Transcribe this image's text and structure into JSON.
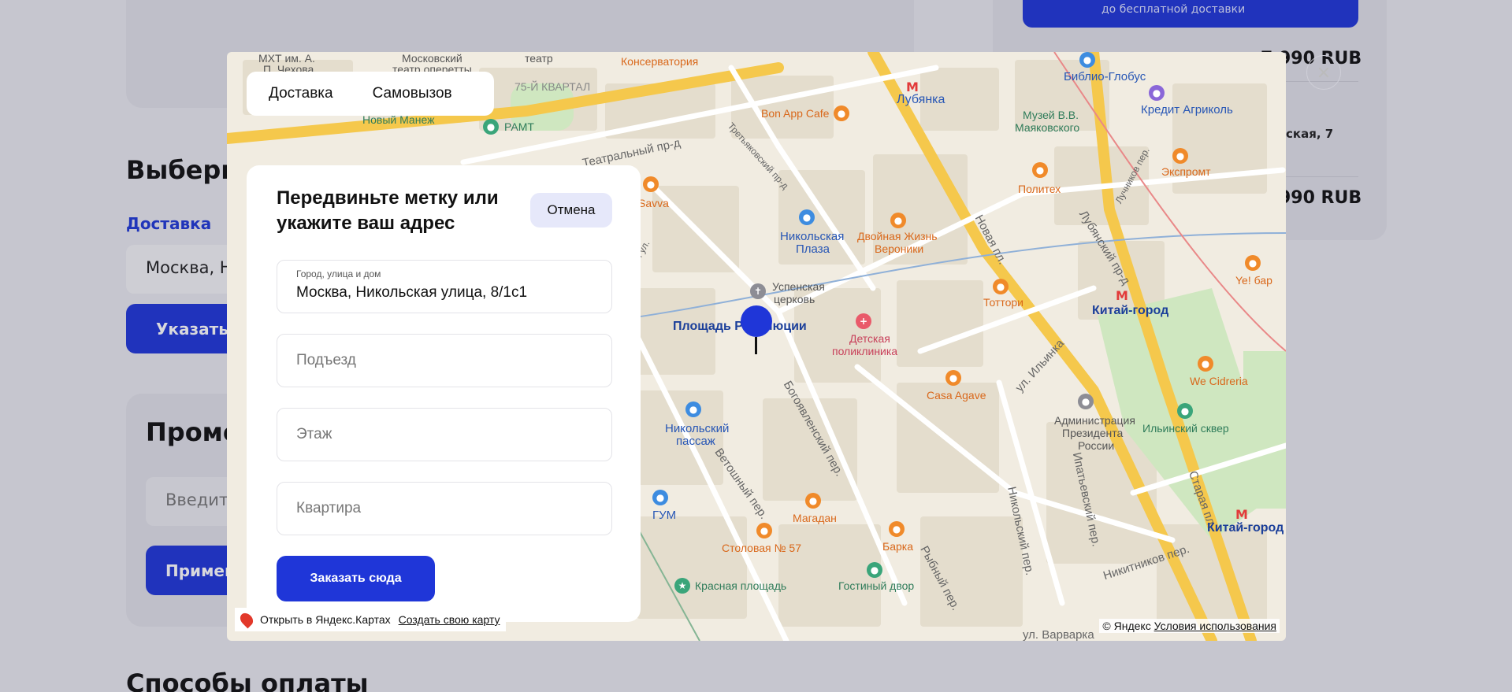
{
  "background": {
    "choose_heading": "Выберит",
    "delivery_link": "Доставка",
    "address_input": "Москва, Ни",
    "specify_button": "Указать а",
    "promo_heading": "Промо",
    "promo_input": "Введите",
    "apply_button": "Примени",
    "payment_heading": "Способы оплаты",
    "free_delivery_text": "до бесплатной доставки",
    "price_1": "7 990 RUB",
    "price_2": "7 990 RUB",
    "pickup_address": "ская, 7"
  },
  "modal": {
    "tabs": [
      "Доставка",
      "Самовызов"
    ],
    "title": "Передвиньте метку или укажите ваш адрес",
    "cancel_button": "Отмена",
    "address_field": {
      "label": "Город, улица и дом",
      "value": "Москва, Никольская улица, 8/1с1"
    },
    "entrance_placeholder": "Подъезд",
    "floor_placeholder": "Этаж",
    "apartment_placeholder": "Квартира",
    "order_button": "Заказать сюда",
    "close_icon": "×"
  },
  "map": {
    "open_in_yandex": "Открыть в Яндекс.Картах",
    "create_map": "Создать свою карту",
    "copyright": "© Яндекс",
    "terms": "Условия использования",
    "labels": {
      "mkhat": "МХТ им. А.",
      "chekhov": "П. Чехова",
      "moscow_operetta": "Московский",
      "operetta_theatre": "театр оперетты",
      "theatre": "театр",
      "conservatory": "Консерватория",
      "kvartal": "75-Й КВАРТАЛ",
      "novy_manezh": "Новый Манеж",
      "ramt": "РАМТ",
      "teatralny": "Театральный пр-д",
      "bon_app": "Bon App Cafe",
      "lubyanka": "Лубянка",
      "biblio_globus": "Библио-Глобус",
      "credit_agricole": "Кредит Агриколь",
      "mayakovsky_museum": "Музей В.В.",
      "mayakovsky": "Маяковского",
      "savva": "Savva",
      "nikolskaya_plaza": "Никольская",
      "plaza": "Плаза",
      "double_life": "Двойная Жизнь",
      "veroniki": "Вероники",
      "politekh": "Политех",
      "ekspromt": "Экспромт",
      "novaya_pl": "Новая пл.",
      "lubyansky": "Лубянский пр-д",
      "uspenskaya": "Успенская",
      "church": "церковь",
      "ploshchad_rev": "Площадь Революции",
      "detskaya": "Детская",
      "poliklinika": "поликлиника",
      "tottori": "Тоттори",
      "kitay_gorod": "Китай-город",
      "ye_bar": "Ye! бар",
      "casa_agave": "Casa Agave",
      "ilyinka": "ул. Ильинка",
      "we_cidreria": "We Cidreria",
      "nikolsky_passage": "Никольский",
      "passage": "пассаж",
      "bogoyavlensky": "Богоявленский пер.",
      "administration": "Администрация",
      "president": "Президента",
      "russia": "России",
      "ilinsky_skver": "Ильинский сквер",
      "staraya_pl": "Старая пл.",
      "gum": "ГУМ",
      "vetoshny": "Ветошный пер.",
      "magadan": "Магадан",
      "stolovaya": "Столовая № 57",
      "barka": "Барка",
      "kitay_gorod_2": "Китай-город",
      "krasnaya_pl": "Красная площадь",
      "gostiny_dvor": "Гостиный двор",
      "rybny": "Рыбный пер.",
      "nikolsky_per": "Никольский пер.",
      "ipatievsky": "Ипатьевский пер.",
      "nikitnikov": "Никитников пер.",
      "varvarka": "ул. Варварка",
      "nikolskaya_ul": "Никольская ул.",
      "tretyakovsky": "Третьяковский пр-д",
      "luchnikov": "Лучников пер."
    }
  },
  "colors": {
    "accent": "#1f36d8",
    "cancel_bg": "#e6e8fa",
    "map_bg": "#f1ece1"
  }
}
